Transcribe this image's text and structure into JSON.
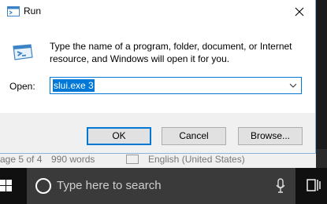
{
  "background_app": {
    "status_page": "age 5 of 4",
    "status_words": "990 words",
    "status_language": "English (United States)"
  },
  "dialog": {
    "title": "Run",
    "description": "Type the name of a program, folder, document, or Internet resource, and Windows will open it for you.",
    "open_label": "Open:",
    "open_value": "slui.exe 3",
    "buttons": {
      "ok": "OK",
      "cancel": "Cancel",
      "browse": "Browse..."
    }
  },
  "taskbar": {
    "search_placeholder": "Type here to search"
  },
  "colors": {
    "accent": "#0078d7",
    "dialog_bg": "#f0f0f0",
    "taskbar_bg": "#101010"
  },
  "icons": [
    "run-app-icon",
    "close-icon",
    "dropdown-arrow-icon",
    "windows-start-icon",
    "search-icon",
    "microphone-icon",
    "task-view-icon"
  ]
}
